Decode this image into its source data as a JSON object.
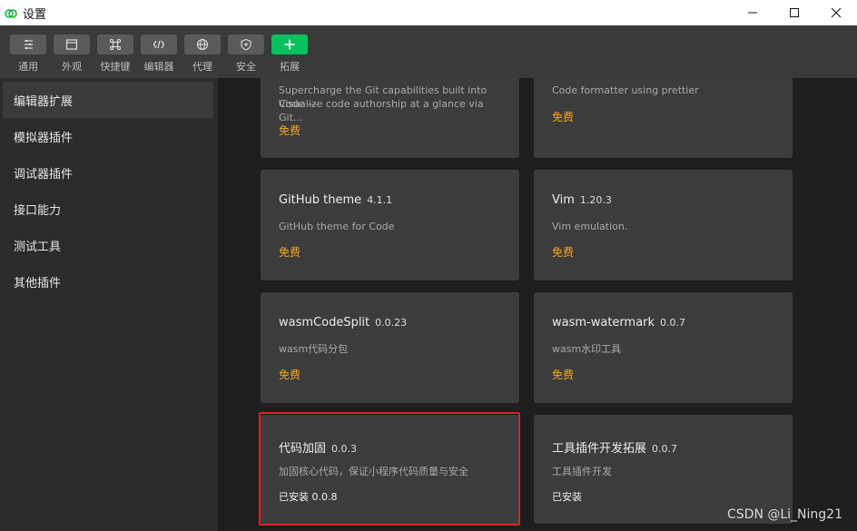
{
  "window": {
    "title": "设置"
  },
  "toolbar": {
    "items": [
      {
        "label": "通用",
        "icon": "list-icon"
      },
      {
        "label": "外观",
        "icon": "window-icon"
      },
      {
        "label": "快捷键",
        "icon": "command-icon"
      },
      {
        "label": "编辑器",
        "icon": "code-icon"
      },
      {
        "label": "代理",
        "icon": "globe-icon"
      },
      {
        "label": "安全",
        "icon": "shield-icon"
      },
      {
        "label": "拓展",
        "icon": "plus-icon"
      }
    ]
  },
  "sidebar": {
    "items": [
      {
        "label": "编辑器扩展"
      },
      {
        "label": "模拟器插件"
      },
      {
        "label": "调试器插件"
      },
      {
        "label": "接口能力"
      },
      {
        "label": "测试工具"
      },
      {
        "label": "其他插件"
      }
    ]
  },
  "extensions": [
    {
      "name": "",
      "version": "",
      "desc1": "Supercharge the Git capabilities built into Code —",
      "desc2": "Visualize code authorship at a glance via Git...",
      "status": "免费"
    },
    {
      "name": "",
      "version": "",
      "desc1": "Code formatter using prettier",
      "desc2": "",
      "status": "免费"
    },
    {
      "name": "GitHub theme",
      "version": "4.1.1",
      "desc1": "GitHub theme for Code",
      "desc2": "",
      "status": "免费"
    },
    {
      "name": "Vim",
      "version": "1.20.3",
      "desc1": "Vim emulation.",
      "desc2": "",
      "status": "免费"
    },
    {
      "name": "wasmCodeSplit",
      "version": "0.0.23",
      "desc1": "wasm代码分包",
      "desc2": "",
      "status": "免费"
    },
    {
      "name": "wasm-watermark",
      "version": "0.0.7",
      "desc1": "wasm水印工具",
      "desc2": "",
      "status": "免费"
    },
    {
      "name": "代码加固",
      "version": "0.0.3",
      "desc1": "加固核心代码，保证小程序代码质量与安全",
      "desc2": "",
      "status": "已安装 0.0.8"
    },
    {
      "name": "工具插件开发拓展",
      "version": "0.0.7",
      "desc1": "工具插件开发",
      "desc2": "",
      "status": "已安装"
    }
  ],
  "watermark": "CSDN @Li_Ning21",
  "colors": {
    "accent": "#07c160",
    "price": "#f5a623",
    "highlight": "#e02020"
  }
}
